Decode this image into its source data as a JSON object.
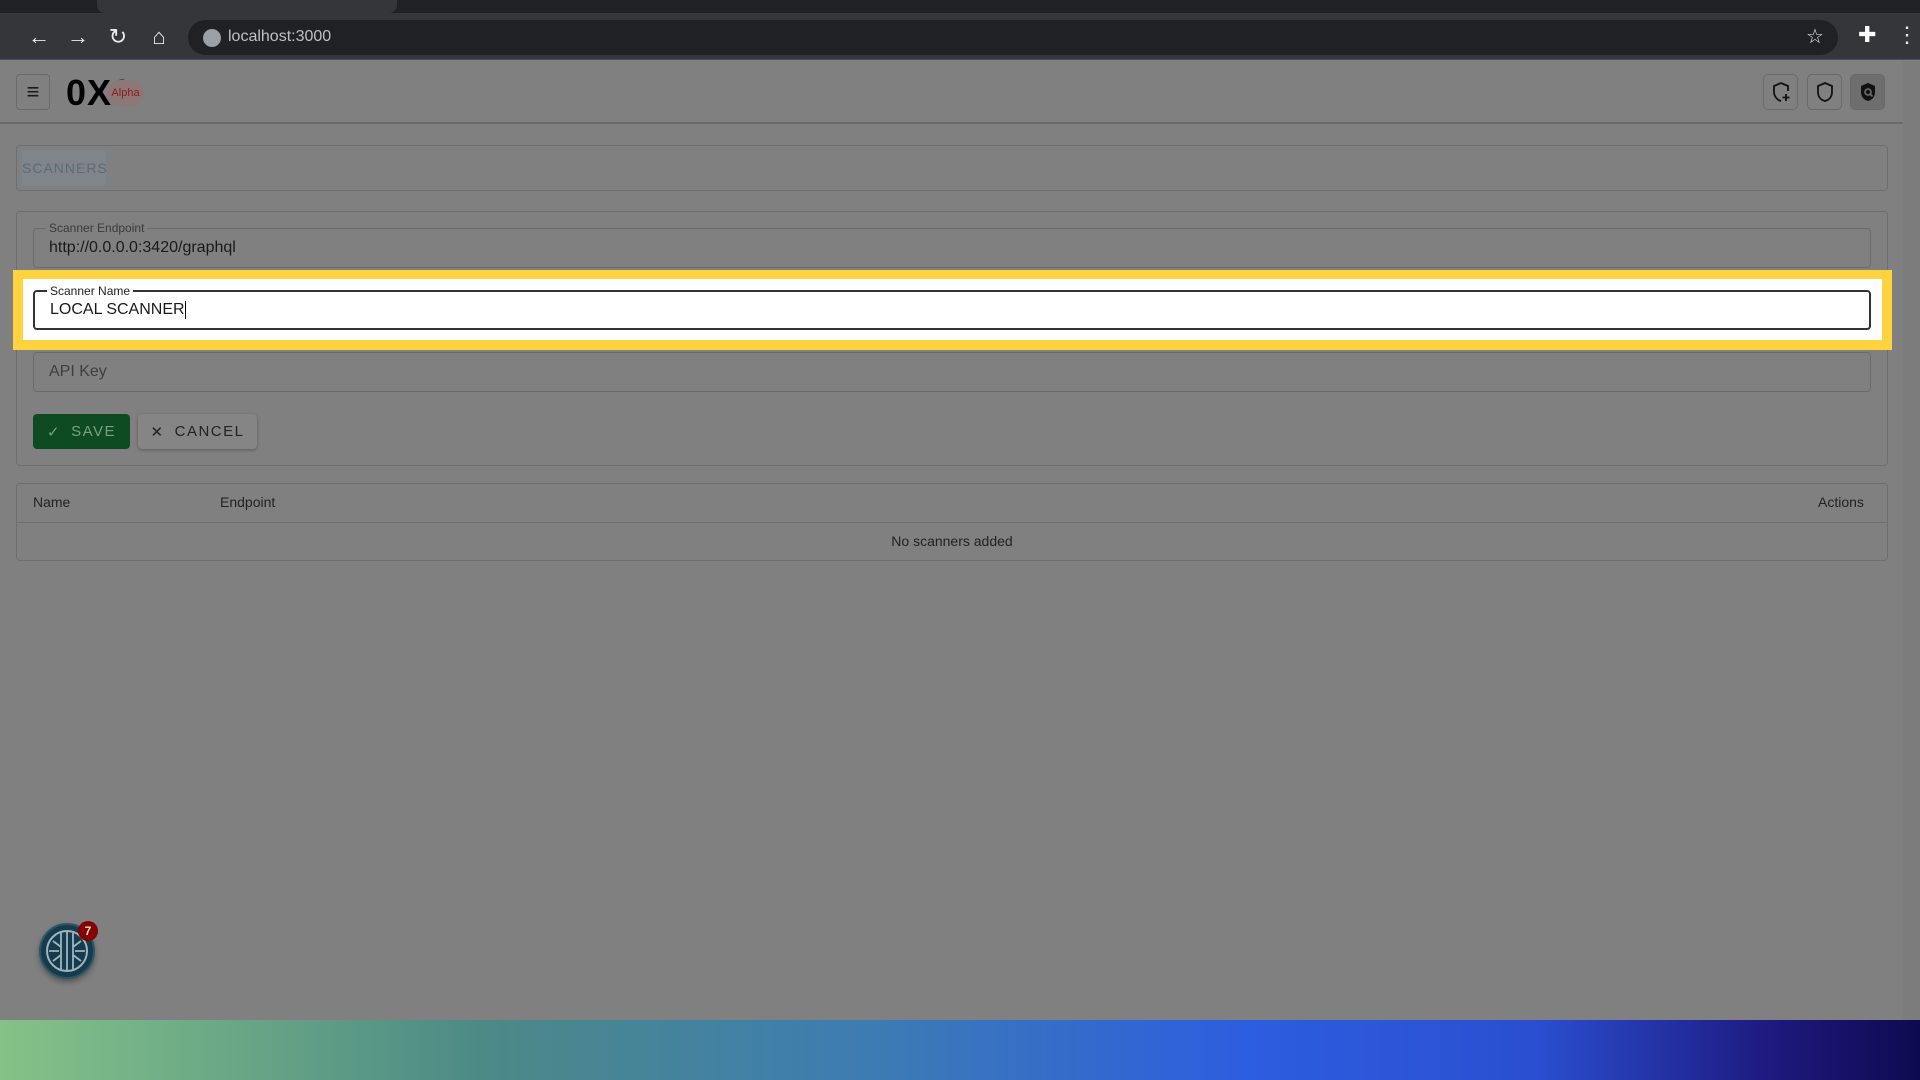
{
  "browser": {
    "url": "localhost:3000",
    "icons": [
      "back-icon",
      "forward-icon",
      "reload-icon",
      "home-icon",
      "globe-icon",
      "star-icon",
      "extensions-icon",
      "more-icon"
    ]
  },
  "header": {
    "logo": "0X0",
    "badge": "Alpha",
    "actions": [
      "shield-plus-icon",
      "shield-icon",
      "shield-search-icon"
    ]
  },
  "tabs": [
    {
      "label": "SCANNERS",
      "active": true
    }
  ],
  "form": {
    "endpoint": {
      "label": "Scanner Endpoint",
      "value": "http://0.0.0.0:3420/graphql"
    },
    "name": {
      "label": "Scanner Name",
      "value": "LOCAL SCANNER"
    },
    "api_key": {
      "placeholder": "API Key",
      "value": ""
    },
    "save_label": "SAVE",
    "cancel_label": "CANCEL"
  },
  "table": {
    "columns": [
      "Name",
      "Endpoint",
      "Actions"
    ],
    "empty_message": "No scanners added"
  },
  "notifications": {
    "count": "7"
  },
  "colors": {
    "highlight": "#ffd33f",
    "save": "#1b5e20",
    "alpha_badge": "#b71c1c"
  }
}
